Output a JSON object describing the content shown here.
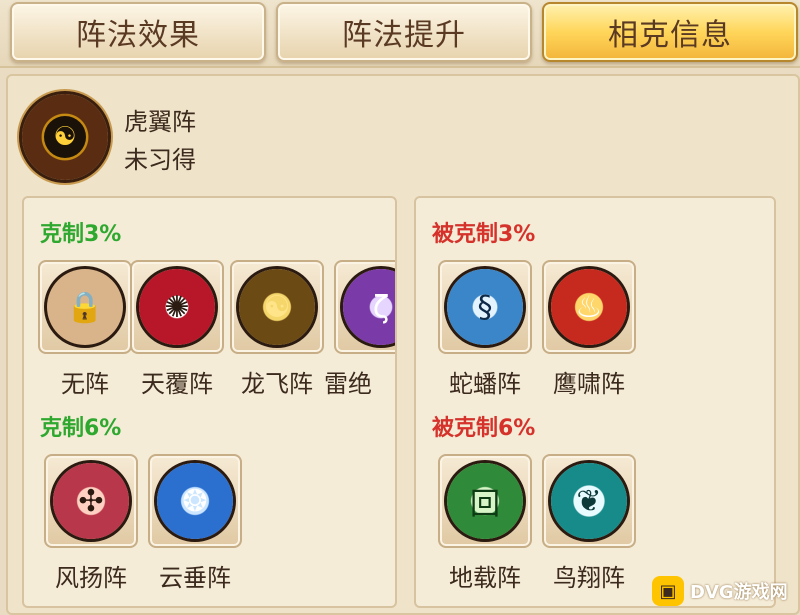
{
  "tabs": [
    {
      "label": "阵法效果",
      "active": false
    },
    {
      "label": "阵法提升",
      "active": false
    },
    {
      "label": "相克信息",
      "active": true
    }
  ],
  "formation": {
    "name": "虎翼阵",
    "status": "未习得",
    "emblem_icon": "tiger-wing-emblem-icon"
  },
  "counters": {
    "restrain_3": {
      "title": "克制3%",
      "items": [
        {
          "label": "无阵",
          "icon": "lock-icon",
          "glyph": "🔒",
          "color": "#d9b48a"
        },
        {
          "label": "天覆阵",
          "icon": "heaven-cover-emblem-icon",
          "glyph": "✺",
          "color": "#b8172a"
        },
        {
          "label": "龙飞阵",
          "icon": "dragon-fly-emblem-icon",
          "glyph": "☯",
          "color": "#c89a1c"
        },
        {
          "label": "雷绝",
          "icon": "thunder-emblem-icon",
          "glyph": "ζ",
          "color": "#7a3aa8"
        }
      ]
    },
    "restrain_6": {
      "title": "克制6%",
      "items": [
        {
          "label": "风扬阵",
          "icon": "wind-rise-emblem-icon",
          "glyph": "✣",
          "color": "#b8374a"
        },
        {
          "label": "云垂阵",
          "icon": "cloud-hang-emblem-icon",
          "glyph": "❂",
          "color": "#2b6fcf"
        }
      ]
    },
    "restrained_3": {
      "title": "被克制3%",
      "items": [
        {
          "label": "蛇蟠阵",
          "icon": "coiled-snake-emblem-icon",
          "glyph": "§",
          "color": "#3a86c8"
        },
        {
          "label": "鹰啸阵",
          "icon": "eagle-cry-emblem-icon",
          "glyph": "♨",
          "color": "#c62a1f"
        }
      ]
    },
    "restrained_6": {
      "title": "被克制6%",
      "items": [
        {
          "label": "地载阵",
          "icon": "earth-bear-emblem-icon",
          "glyph": "回",
          "color": "#2f8a3a"
        },
        {
          "label": "鸟翔阵",
          "icon": "bird-soar-emblem-icon",
          "glyph": "❦",
          "color": "#178a8a"
        }
      ]
    }
  },
  "watermark": {
    "text": "DVG游戏网",
    "icon": "gamepad-icon",
    "glyph": "▣"
  }
}
